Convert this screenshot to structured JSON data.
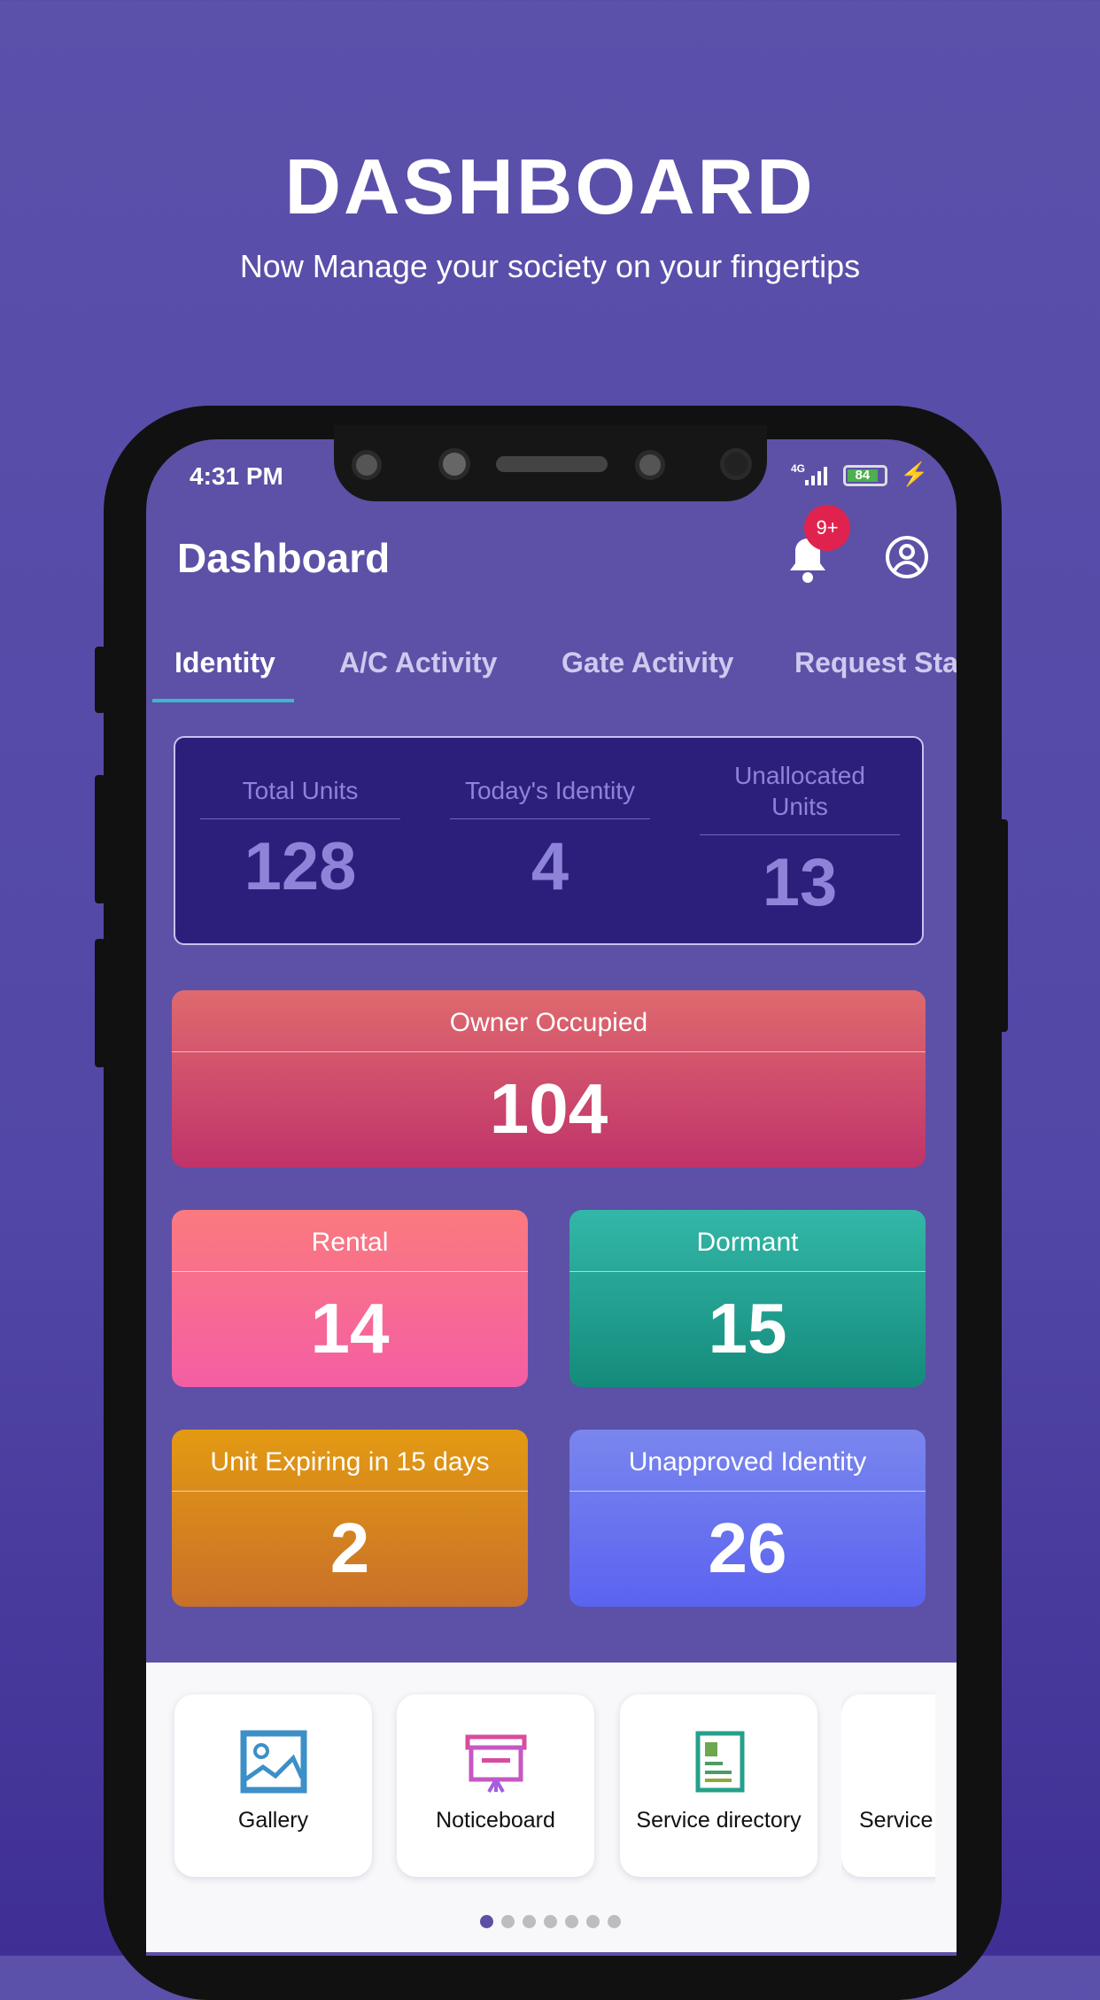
{
  "promo": {
    "title": "DASHBOARD",
    "subtitle": "Now Manage your society on your fingertips"
  },
  "status_bar": {
    "time": "4:31 PM",
    "network": "4G",
    "battery": "84"
  },
  "header": {
    "title": "Dashboard",
    "notification_badge": "9+"
  },
  "tabs": [
    {
      "label": "Identity",
      "active": true
    },
    {
      "label": "A/C Activity"
    },
    {
      "label": "Gate Activity"
    },
    {
      "label": "Request Stat"
    }
  ],
  "summary": [
    {
      "label": "Total Units",
      "value": "128"
    },
    {
      "label": "Today's Identity",
      "value": "4"
    },
    {
      "label": "Unallocated Units",
      "value": "13"
    }
  ],
  "cards": [
    {
      "label": "Owner Occupied",
      "value": "104",
      "color": "#d14f73"
    },
    {
      "label": "Rental",
      "value": "14",
      "color": "#f76a96"
    },
    {
      "label": "Dormant",
      "value": "15",
      "color": "#1f9e8c"
    },
    {
      "label": "Unit Expiring in 15 days",
      "value": "2",
      "color": "#d17f1a"
    },
    {
      "label": "Unapproved Identity",
      "value": "26",
      "color": "#6a72ee"
    }
  ],
  "shortcuts": [
    {
      "label": "Gallery",
      "icon": "gallery-icon"
    },
    {
      "label": "Noticeboard",
      "icon": "noticeboard-icon"
    },
    {
      "label": "Service directory",
      "icon": "service-directory-icon"
    },
    {
      "label": "Service",
      "icon": "service-home-icon"
    }
  ],
  "pager": {
    "pages": 7,
    "current": 1
  }
}
